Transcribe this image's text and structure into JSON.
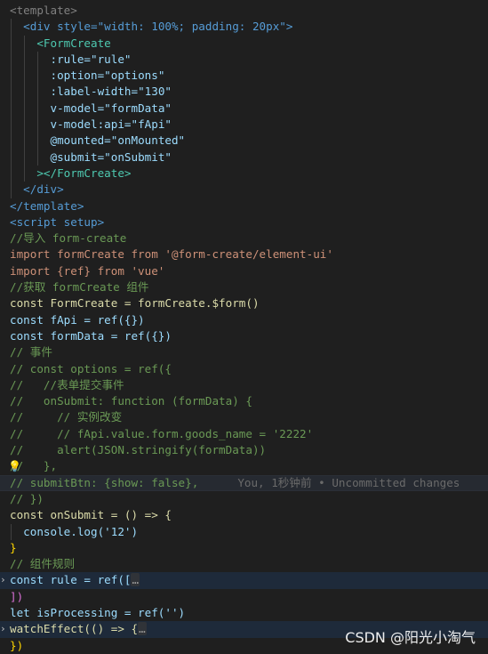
{
  "editor": {
    "lines": [
      "<template>",
      "<div style=\"width: 100%; padding: 20px\">",
      "<FormCreate",
      ":rule=\"rule\"",
      ":option=\"options\"",
      ":label-width=\"130\"",
      "v-model=\"formData\"",
      "v-model:api=\"fApi\"",
      "@mounted=\"onMounted\"",
      "@submit=\"onSubmit\"",
      "></FormCreate>",
      "</div>",
      "</template>",
      "<script setup>",
      "//导入 form-create",
      "import formCreate from '@form-create/element-ui'",
      "import {ref} from 'vue'",
      "//获取 formCreate 组件",
      "const FormCreate = formCreate.$form()",
      "const fApi = ref({})",
      "const formData = ref({})",
      "// 事件",
      "// const options = ref({",
      "//   //表单提交事件",
      "//   onSubmit: function (formData) {",
      "//     // 实例改变",
      "//     // fApi.value.form.goods_name = '2222'",
      "//     alert(JSON.stringify(formData))",
      "//   },",
      "// submitBtn: {show: false},",
      "// })",
      "const onSubmit = () => {",
      "console.log('12')",
      "}",
      "// 组件规则",
      "const rule = ref([",
      "])",
      "let isProcessing = ref('')",
      "watchEffect(() => {",
      "})"
    ],
    "blame": "You, 1秒钟前 • Uncommitted changes",
    "fold_placeholder": "…"
  },
  "watermark": "CSDN @阳光小淘气",
  "colors": {
    "background": "#1f1f1f",
    "keyword": "#569cd6",
    "string": "#ce9178",
    "comment": "#6a9955",
    "variable": "#9cdcfe",
    "function": "#dcdcaa",
    "component": "#4ec9b0",
    "bracket_gold": "#ffd700",
    "bracket_purple": "#da70d6"
  },
  "icons": [
    "fold-chevron-icon",
    "lightbulb-icon"
  ]
}
